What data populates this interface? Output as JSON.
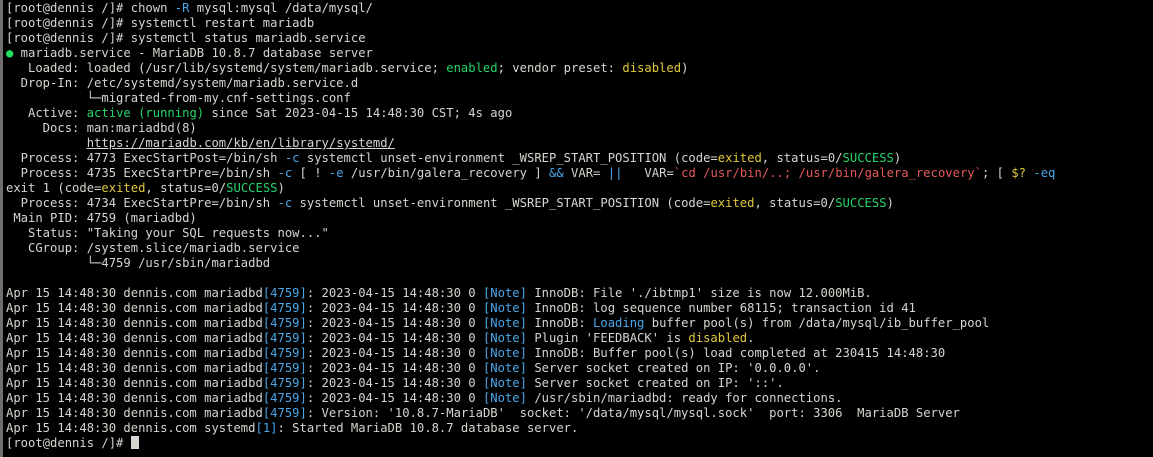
{
  "terminal": {
    "colors": {
      "background": "#000000",
      "text": "#d3d7cf",
      "green": "#22d46a",
      "yellow": "#e0c93a",
      "blue": "#4aa6e8",
      "red": "#e35a5a"
    },
    "lines": [
      [
        [
          "w",
          "[root@dennis /]# chown "
        ],
        [
          "b",
          "-R"
        ],
        [
          "w",
          " mysql:mysql /data/mysql/"
        ]
      ],
      [
        [
          "w",
          "[root@dennis /]# systemctl restart mariadb"
        ]
      ],
      [
        [
          "w",
          "[root@dennis /]# systemctl status mariadb.service"
        ]
      ],
      [
        [
          "dot",
          "●"
        ],
        [
          "w",
          " mariadb.service - MariaDB 10.8.7 database server"
        ]
      ],
      [
        [
          "w",
          "   Loaded: loaded (/usr/lib/systemd/system/mariadb.service; "
        ],
        [
          "g",
          "enabled"
        ],
        [
          "w",
          "; vendor preset: "
        ],
        [
          "y",
          "disabled"
        ],
        [
          "w",
          ")"
        ]
      ],
      [
        [
          "w",
          "  Drop-In: /etc/systemd/system/mariadb.service.d"
        ]
      ],
      [
        [
          "w",
          "           └─migrated-from-my.cnf-settings.conf"
        ]
      ],
      [
        [
          "w",
          "   Active: "
        ],
        [
          "g",
          "active (running)"
        ],
        [
          "w",
          " since Sat 2023-04-15 14:48:30 CST; 4s ago"
        ]
      ],
      [
        [
          "w",
          "     Docs: man:mariadbd(8)"
        ]
      ],
      [
        [
          "w",
          "           "
        ],
        [
          "u",
          "https://mariadb.com/kb/en/library/systemd/"
        ]
      ],
      [
        [
          "w",
          "  Process: 4773 ExecStartPost=/bin/sh "
        ],
        [
          "b",
          "-c"
        ],
        [
          "w",
          " systemctl unset-environment _WSREP_START_POSITION (code="
        ],
        [
          "y",
          "exited"
        ],
        [
          "w",
          ", status=0/"
        ],
        [
          "g",
          "SUCCESS"
        ],
        [
          "w",
          ")"
        ]
      ],
      [
        [
          "w",
          "  Process: 4735 ExecStartPre=/bin/sh "
        ],
        [
          "b",
          "-c"
        ],
        [
          "w",
          " [ ! "
        ],
        [
          "b",
          "-e"
        ],
        [
          "w",
          " /usr/bin/galera_recovery ] "
        ],
        [
          "b",
          "&&"
        ],
        [
          "w",
          " VAR= "
        ],
        [
          "b",
          "||"
        ],
        [
          "w",
          "   VAR="
        ],
        [
          "r",
          "`cd /usr/bin/..; /usr/bin/galera_recovery`"
        ],
        [
          "w",
          "; [ "
        ],
        [
          "y",
          "$?"
        ],
        [
          "w",
          " "
        ],
        [
          "b",
          "-eq"
        ]
      ],
      [
        [
          "w",
          "exit 1 (code="
        ],
        [
          "y",
          "exited"
        ],
        [
          "w",
          ", status=0/"
        ],
        [
          "g",
          "SUCCESS"
        ],
        [
          "w",
          ")"
        ]
      ],
      [
        [
          "w",
          "  Process: 4734 ExecStartPre=/bin/sh "
        ],
        [
          "b",
          "-c"
        ],
        [
          "w",
          " systemctl unset-environment _WSREP_START_POSITION (code="
        ],
        [
          "y",
          "exited"
        ],
        [
          "w",
          ", status=0/"
        ],
        [
          "g",
          "SUCCESS"
        ],
        [
          "w",
          ")"
        ]
      ],
      [
        [
          "w",
          " Main PID: 4759 (mariadbd)"
        ]
      ],
      [
        [
          "w",
          "   Status: \"Taking your SQL requests now...\""
        ]
      ],
      [
        [
          "w",
          "   CGroup: /system.slice/mariadb.service"
        ]
      ],
      [
        [
          "w",
          "           └─4759 /usr/sbin/mariadbd"
        ]
      ],
      [
        [
          "w",
          ""
        ]
      ],
      [
        [
          "w",
          "Apr 15 14:48:30 dennis.com mariadbd"
        ],
        [
          "b",
          "[4759]"
        ],
        [
          "w",
          ": 2023-04-15 14:48:30 0 "
        ],
        [
          "b",
          "[Note]"
        ],
        [
          "w",
          " InnoDB: File './ibtmp1' size is now 12.000MiB."
        ]
      ],
      [
        [
          "w",
          "Apr 15 14:48:30 dennis.com mariadbd"
        ],
        [
          "b",
          "[4759]"
        ],
        [
          "w",
          ": 2023-04-15 14:48:30 0 "
        ],
        [
          "b",
          "[Note]"
        ],
        [
          "w",
          " InnoDB: log sequence number 68115; transaction id 41"
        ]
      ],
      [
        [
          "w",
          "Apr 15 14:48:30 dennis.com mariadbd"
        ],
        [
          "b",
          "[4759]"
        ],
        [
          "w",
          ": 2023-04-15 14:48:30 0 "
        ],
        [
          "b",
          "[Note]"
        ],
        [
          "w",
          " InnoDB: "
        ],
        [
          "b",
          "Loading"
        ],
        [
          "w",
          " buffer pool(s) from /data/mysql/ib_buffer_pool"
        ]
      ],
      [
        [
          "w",
          "Apr 15 14:48:30 dennis.com mariadbd"
        ],
        [
          "b",
          "[4759]"
        ],
        [
          "w",
          ": 2023-04-15 14:48:30 0 "
        ],
        [
          "b",
          "[Note]"
        ],
        [
          "w",
          " Plugin 'FEEDBACK' is "
        ],
        [
          "y",
          "disabled"
        ],
        [
          "w",
          "."
        ]
      ],
      [
        [
          "w",
          "Apr 15 14:48:30 dennis.com mariadbd"
        ],
        [
          "b",
          "[4759]"
        ],
        [
          "w",
          ": 2023-04-15 14:48:30 0 "
        ],
        [
          "b",
          "[Note]"
        ],
        [
          "w",
          " InnoDB: Buffer pool(s) load completed at 230415 14:48:30"
        ]
      ],
      [
        [
          "w",
          "Apr 15 14:48:30 dennis.com mariadbd"
        ],
        [
          "b",
          "[4759]"
        ],
        [
          "w",
          ": 2023-04-15 14:48:30 0 "
        ],
        [
          "b",
          "[Note]"
        ],
        [
          "w",
          " Server socket created on IP: '0.0.0.0'."
        ]
      ],
      [
        [
          "w",
          "Apr 15 14:48:30 dennis.com mariadbd"
        ],
        [
          "b",
          "[4759]"
        ],
        [
          "w",
          ": 2023-04-15 14:48:30 0 "
        ],
        [
          "b",
          "[Note]"
        ],
        [
          "w",
          " Server socket created on IP: '::'."
        ]
      ],
      [
        [
          "w",
          "Apr 15 14:48:30 dennis.com mariadbd"
        ],
        [
          "b",
          "[4759]"
        ],
        [
          "w",
          ": 2023-04-15 14:48:30 0 "
        ],
        [
          "b",
          "[Note]"
        ],
        [
          "w",
          " /usr/sbin/mariadbd: ready for connections."
        ]
      ],
      [
        [
          "w",
          "Apr 15 14:48:30 dennis.com mariadbd"
        ],
        [
          "b",
          "[4759]"
        ],
        [
          "w",
          ": Version: '10.8.7-MariaDB'  socket: '/data/mysql/mysql.sock'  port: 3306  MariaDB Server"
        ]
      ],
      [
        [
          "w",
          "Apr 15 14:48:30 dennis.com systemd"
        ],
        [
          "b",
          "[1]"
        ],
        [
          "w",
          ": Started MariaDB 10.8.7 database server."
        ]
      ]
    ],
    "prompt": "[root@dennis /]# "
  }
}
